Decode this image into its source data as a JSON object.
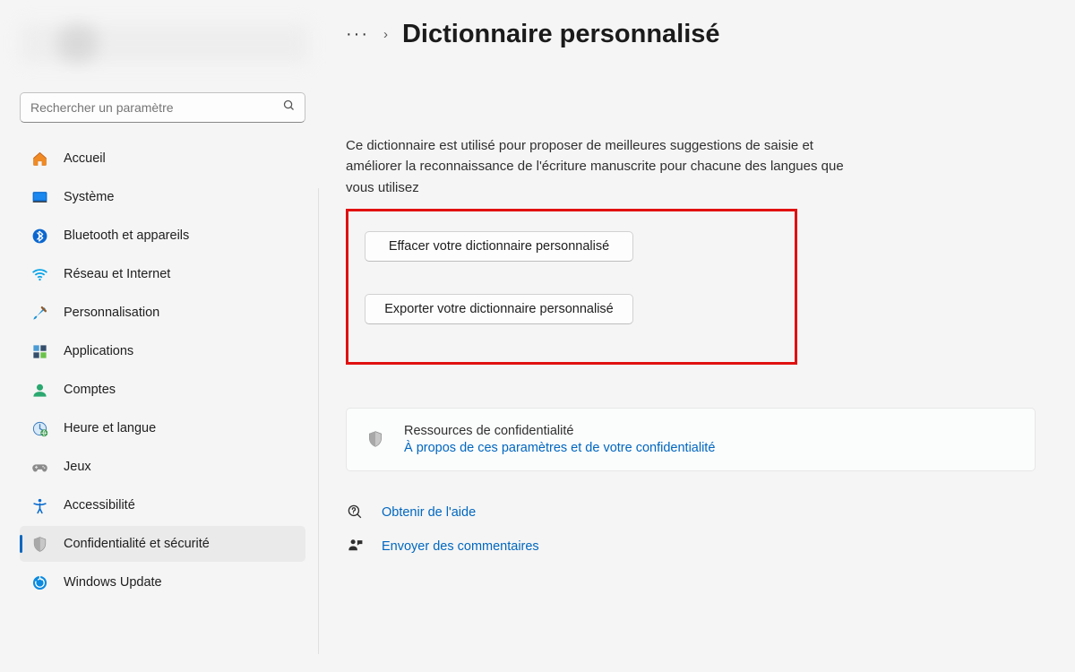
{
  "search": {
    "placeholder": "Rechercher un paramètre"
  },
  "sidebar": {
    "items": [
      {
        "label": "Accueil"
      },
      {
        "label": "Système"
      },
      {
        "label": "Bluetooth et appareils"
      },
      {
        "label": "Réseau et Internet"
      },
      {
        "label": "Personnalisation"
      },
      {
        "label": "Applications"
      },
      {
        "label": "Comptes"
      },
      {
        "label": "Heure et langue"
      },
      {
        "label": "Jeux"
      },
      {
        "label": "Accessibilité"
      },
      {
        "label": "Confidentialité et sécurité"
      },
      {
        "label": "Windows Update"
      }
    ]
  },
  "breadcrumb": {
    "dots": "···",
    "chevron": "›"
  },
  "page": {
    "title": "Dictionnaire personnalisé",
    "description": "Ce dictionnaire est utilisé pour proposer de meilleures suggestions de saisie et améliorer la reconnaissance de l'écriture manuscrite pour chacune des langues que vous utilisez",
    "clear_btn": "Effacer votre dictionnaire personnalisé",
    "export_btn": "Exporter votre dictionnaire personnalisé"
  },
  "privacy_card": {
    "title": "Ressources de confidentialité",
    "link": "À propos de ces paramètres et de votre confidentialité"
  },
  "footer": {
    "help": "Obtenir de l'aide",
    "feedback": "Envoyer des commentaires"
  }
}
